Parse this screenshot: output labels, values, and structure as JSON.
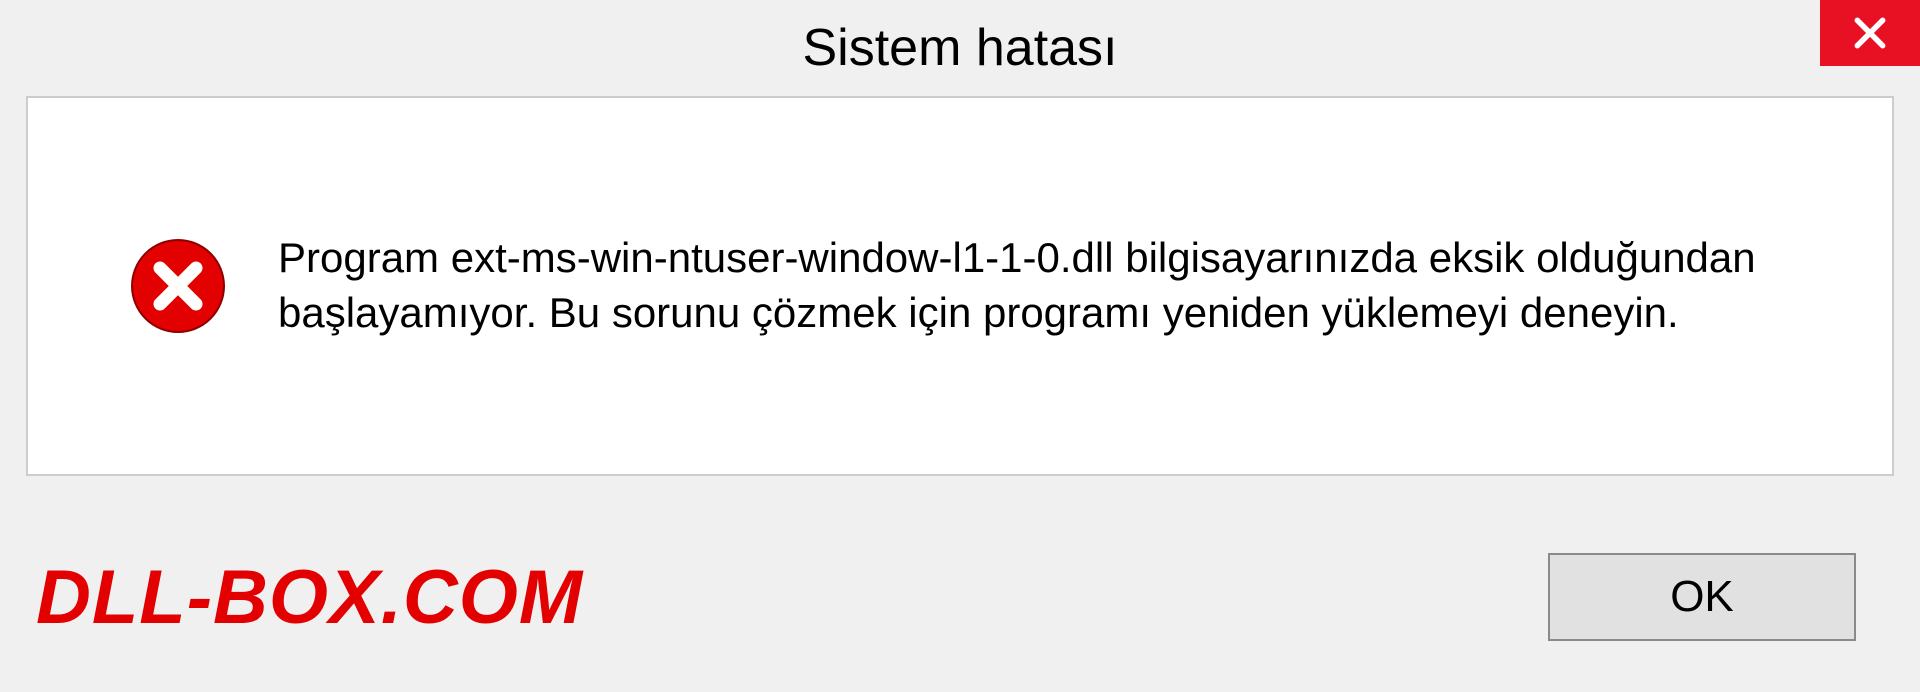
{
  "titlebar": {
    "title": "Sistem hatası"
  },
  "content": {
    "message": "Program ext-ms-win-ntuser-window-l1-1-0.dll bilgisayarınızda eksik olduğundan başlayamıyor. Bu sorunu çözmek için programı yeniden yüklemeyi deneyin."
  },
  "footer": {
    "watermark": "DLL-BOX.COM",
    "ok_label": "OK"
  },
  "colors": {
    "close_bg": "#e81123",
    "error_icon": "#e20000",
    "watermark": "#e20000"
  }
}
